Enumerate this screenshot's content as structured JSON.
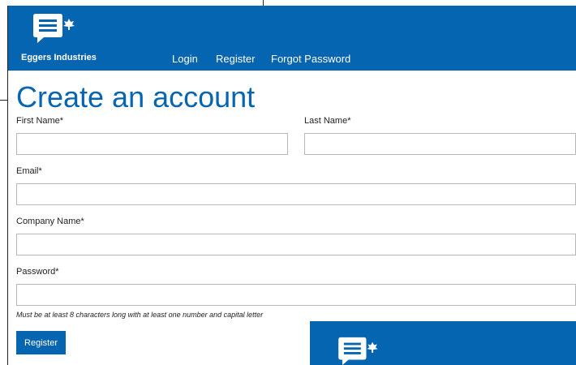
{
  "header": {
    "brand": "Eggers Industries",
    "nav": [
      "Login",
      "Register",
      "Forgot Password"
    ]
  },
  "form": {
    "title": "Create an account",
    "first_name_label": "First Name*",
    "last_name_label": "Last Name*",
    "email_label": "Email*",
    "company_label": "Company Name*",
    "password_label": "Password*",
    "password_hint": "Must be at least 8 characters long with at least one number and capital letter",
    "first_name_value": "",
    "last_name_value": "",
    "email_value": "",
    "company_value": "",
    "password_value": "",
    "register_button": "Register"
  },
  "colors": {
    "brand_blue": "#0565b0"
  },
  "icons": {
    "logo": "speech-bubble-leaf-icon"
  }
}
